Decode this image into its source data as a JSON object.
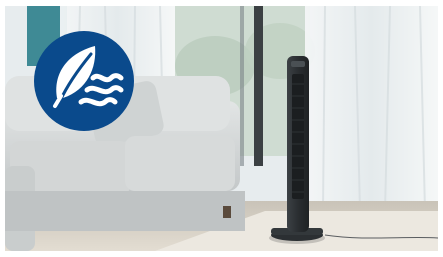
{
  "scene": {
    "description_icon": "leaf-wind-icon",
    "colors": {
      "badge_blue": "#0a4a8c",
      "badge_white": "#ffffff",
      "fan_body": "#2f3336",
      "sofa": "#d9dcdc",
      "wall_teal": "#3f8a95"
    }
  }
}
